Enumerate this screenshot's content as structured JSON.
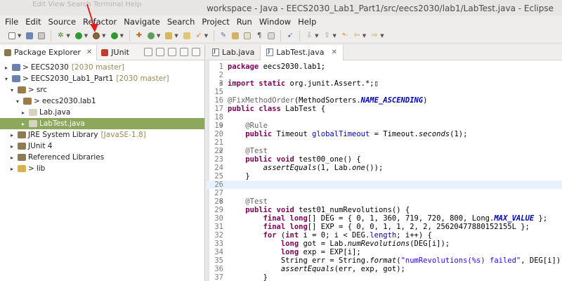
{
  "window": {
    "title": "workspace - Java - EECS2030_Lab1_Part1/src/eecs2030/lab1/LabTest.java - Eclipse",
    "background_dim_text": "Edit  View  Search  Terminal  Help"
  },
  "menubar": [
    "File",
    "Edit",
    "Source",
    "Refactor",
    "Navigate",
    "Search",
    "Project",
    "Run",
    "Window",
    "Help"
  ],
  "left_panel": {
    "tabs": [
      {
        "label": "Package Explorer",
        "active": true
      },
      {
        "label": "JUnit",
        "active": false
      }
    ],
    "tree": [
      {
        "indent": 0,
        "twisty": "▸",
        "prefix": ">",
        "label": "EECS2030",
        "git": "[2030 master]",
        "icon": "project",
        "selected": false
      },
      {
        "indent": 0,
        "twisty": "▾",
        "prefix": ">",
        "label": "EECS2030_Lab1_Part1",
        "git": "[2030 master]",
        "icon": "project",
        "selected": false
      },
      {
        "indent": 1,
        "twisty": "▾",
        "prefix": ">",
        "label": "src",
        "git": "",
        "icon": "src",
        "selected": false
      },
      {
        "indent": 2,
        "twisty": "▾",
        "prefix": ">",
        "label": "eecs2030.lab1",
        "git": "",
        "icon": "package",
        "selected": false
      },
      {
        "indent": 3,
        "twisty": "▸",
        "prefix": "",
        "label": "Lab.java",
        "git": "",
        "icon": "java",
        "selected": false
      },
      {
        "indent": 3,
        "twisty": "▸",
        "prefix": "",
        "label": "LabTest.java",
        "git": "",
        "icon": "java",
        "selected": true
      },
      {
        "indent": 1,
        "twisty": "▸",
        "prefix": "",
        "label": "JRE System Library",
        "git": "[JavaSE-1.8]",
        "icon": "library",
        "selected": false
      },
      {
        "indent": 1,
        "twisty": "▸",
        "prefix": "",
        "label": "JUnit 4",
        "git": "",
        "icon": "library",
        "selected": false
      },
      {
        "indent": 1,
        "twisty": "▸",
        "prefix": "",
        "label": "Referenced Libraries",
        "git": "",
        "icon": "library",
        "selected": false
      },
      {
        "indent": 1,
        "twisty": "▸",
        "prefix": ">",
        "label": "lib",
        "git": "",
        "icon": "folder",
        "selected": false
      }
    ]
  },
  "editor": {
    "tabs": [
      {
        "label": "Lab.java",
        "active": false
      },
      {
        "label": "LabTest.java",
        "active": true
      }
    ],
    "lines": [
      {
        "n": "1",
        "fold": "",
        "html": "<span class=\"kw\">package</span> eecs2030.lab1;"
      },
      {
        "n": "2",
        "fold": "",
        "html": ""
      },
      {
        "n": "3",
        "fold": "⊕",
        "html": "<span class=\"kw\">import static</span> org.junit.Assert.*;▯"
      },
      {
        "n": "15",
        "fold": "",
        "html": ""
      },
      {
        "n": "16",
        "fold": "",
        "html": "<span class=\"an\">@FixMethodOrder</span>(MethodSorters.<span class=\"ifld\">NAME_ASCENDING</span>)"
      },
      {
        "n": "17",
        "fold": "",
        "html": "<span class=\"kw\">public class</span> LabTest {"
      },
      {
        "n": "18",
        "fold": "",
        "html": ""
      },
      {
        "n": "19",
        "fold": "⊖",
        "html": "    <span class=\"an\">@Rule</span>"
      },
      {
        "n": "20",
        "fold": "",
        "html": "    <span class=\"kw\">public</span> Timeout <span class=\"fld\">globalTimeout</span> = Timeout.<span class=\"it\">seconds</span>(1);"
      },
      {
        "n": "21",
        "fold": "",
        "html": ""
      },
      {
        "n": "22",
        "fold": "⊖",
        "html": "    <span class=\"an\">@Test</span>"
      },
      {
        "n": "23",
        "fold": "",
        "html": "    <span class=\"kw\">public void</span> test00_one() {"
      },
      {
        "n": "24",
        "fold": "",
        "html": "        <span class=\"it\">assertEquals</span>(1, Lab.<span class=\"it\">one</span>());"
      },
      {
        "n": "25",
        "fold": "",
        "html": "    }"
      },
      {
        "n": "26",
        "fold": "",
        "html": "",
        "current": true
      },
      {
        "n": "27",
        "fold": "",
        "html": ""
      },
      {
        "n": "28",
        "fold": "⊖",
        "html": "    <span class=\"an\">@Test</span>"
      },
      {
        "n": "29",
        "fold": "",
        "html": "    <span class=\"kw\">public void</span> test01_numRevolutions() {"
      },
      {
        "n": "30",
        "fold": "",
        "html": "        <span class=\"kw\">final long</span>[] DEG = { 0, 1, 360, 719, 720, 800, Long.<span class=\"ifld\">MAX_VALUE</span> };"
      },
      {
        "n": "31",
        "fold": "",
        "html": "        <span class=\"kw\">final long</span>[] EXP = { 0, 0, 1, 1, 2, 2, 25620477880152155L };"
      },
      {
        "n": "32",
        "fold": "",
        "html": "        <span class=\"kw\">for</span> (<span class=\"kw\">int</span> i = 0; i &lt; DEG.<span class=\"fld\">length</span>; i++) {"
      },
      {
        "n": "33",
        "fold": "",
        "html": "            <span class=\"kw\">long</span> got = Lab.<span class=\"it\">numRevolutions</span>(DEG[i]);"
      },
      {
        "n": "34",
        "fold": "",
        "html": "            <span class=\"kw\">long</span> exp = EXP[i];"
      },
      {
        "n": "35",
        "fold": "",
        "html": "            String err = String.<span class=\"it\">format</span>(<span class=\"str\">\"numRevolutions(%s) failed\"</span>, DEG[i]);"
      },
      {
        "n": "36",
        "fold": "",
        "html": "            <span class=\"it\">assertEquals</span>(err, exp, got);"
      },
      {
        "n": "37",
        "fold": "",
        "html": "        }"
      }
    ]
  }
}
